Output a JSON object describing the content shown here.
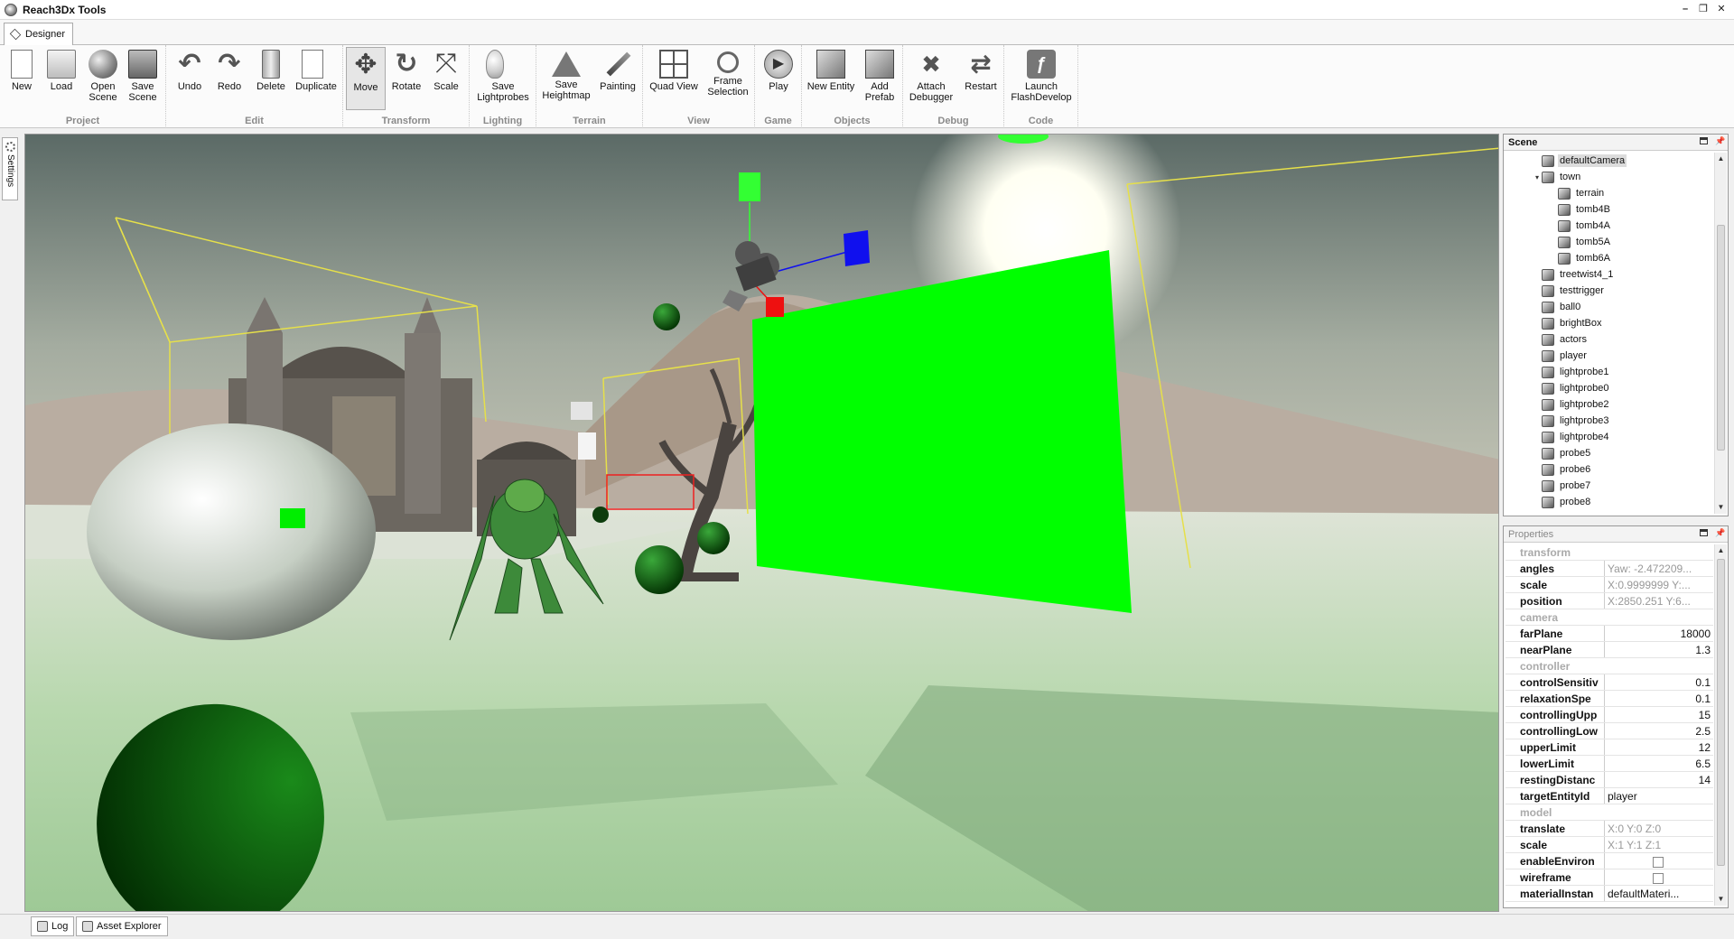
{
  "window": {
    "title": "Reach3Dx Tools",
    "minimize": "–",
    "restore": "❐",
    "close": "✕"
  },
  "tabs": {
    "designer": "Designer"
  },
  "ribbon": {
    "project": {
      "label": "Project",
      "new": "New",
      "load": "Load",
      "open_scene": "Open\nScene",
      "save_scene": "Save\nScene"
    },
    "edit": {
      "label": "Edit",
      "undo": "Undo",
      "redo": "Redo",
      "delete": "Delete",
      "duplicate": "Duplicate"
    },
    "transform": {
      "label": "Transform",
      "move": "Move",
      "rotate": "Rotate",
      "scale": "Scale"
    },
    "lighting": {
      "label": "Lighting",
      "save_lightprobes": "Save\nLightprobes"
    },
    "terrain": {
      "label": "Terrain",
      "save_heightmap": "Save\nHeightmap",
      "painting": "Painting"
    },
    "view": {
      "label": "View",
      "quad_view": "Quad View",
      "frame_selection": "Frame\nSelection"
    },
    "game": {
      "label": "Game",
      "play": "Play"
    },
    "objects": {
      "label": "Objects",
      "new_entity": "New Entity",
      "add_prefab": "Add\nPrefab"
    },
    "debug": {
      "label": "Debug",
      "attach_debugger": "Attach\nDebugger",
      "restart": "Restart"
    },
    "code": {
      "label": "Code",
      "launch_flashdevelop": "Launch\nFlashDevelop"
    }
  },
  "left": {
    "settings": "Settings"
  },
  "scene": {
    "title": "Scene",
    "items": [
      {
        "label": "defaultCamera",
        "depth": 1,
        "selected": true
      },
      {
        "label": "town",
        "depth": 1,
        "expanded": true
      },
      {
        "label": "terrain",
        "depth": 2
      },
      {
        "label": "tomb4B",
        "depth": 2
      },
      {
        "label": "tomb4A",
        "depth": 2
      },
      {
        "label": "tomb5A",
        "depth": 2
      },
      {
        "label": "tomb6A",
        "depth": 2
      },
      {
        "label": "treetwist4_1",
        "depth": 1
      },
      {
        "label": "testtrigger",
        "depth": 1
      },
      {
        "label": "ball0",
        "depth": 1
      },
      {
        "label": "brightBox",
        "depth": 1
      },
      {
        "label": "actors",
        "depth": 1
      },
      {
        "label": "player",
        "depth": 1
      },
      {
        "label": "lightprobe1",
        "depth": 1
      },
      {
        "label": "lightprobe0",
        "depth": 1
      },
      {
        "label": "lightprobe2",
        "depth": 1
      },
      {
        "label": "lightprobe3",
        "depth": 1
      },
      {
        "label": "lightprobe4",
        "depth": 1
      },
      {
        "label": "probe5",
        "depth": 1
      },
      {
        "label": "probe6",
        "depth": 1
      },
      {
        "label": "probe7",
        "depth": 1
      },
      {
        "label": "probe8",
        "depth": 1
      }
    ]
  },
  "properties": {
    "title": "Properties",
    "rows": [
      {
        "type": "cat",
        "label": "transform"
      },
      {
        "name": "angles",
        "value": "Yaw: -2.472209...",
        "style": "grey"
      },
      {
        "name": "scale",
        "value": "X:0.9999999 Y:...",
        "style": "grey"
      },
      {
        "name": "position",
        "value": "X:2850.251 Y:6...",
        "style": "grey"
      },
      {
        "type": "cat",
        "label": "camera"
      },
      {
        "name": "farPlane",
        "value": "18000",
        "style": "num"
      },
      {
        "name": "nearPlane",
        "value": "1.3",
        "style": "num"
      },
      {
        "type": "cat",
        "label": "controller"
      },
      {
        "name": "controlSensitiv",
        "value": "0.1",
        "style": "num"
      },
      {
        "name": "relaxationSpe",
        "value": "0.1",
        "style": "num"
      },
      {
        "name": "controllingUpp",
        "value": "15",
        "style": "num"
      },
      {
        "name": "controllingLow",
        "value": "2.5",
        "style": "num"
      },
      {
        "name": "upperLimit",
        "value": "12",
        "style": "num"
      },
      {
        "name": "lowerLimit",
        "value": "6.5",
        "style": "num"
      },
      {
        "name": "restingDistanc",
        "value": "14",
        "style": "num"
      },
      {
        "name": "targetEntityId",
        "value": "player",
        "style": "text"
      },
      {
        "type": "cat",
        "label": "model"
      },
      {
        "name": "translate",
        "value": "X:0 Y:0 Z:0",
        "style": "grey"
      },
      {
        "name": "scale",
        "value": "X:1 Y:1 Z:1",
        "style": "grey"
      },
      {
        "name": "enableEnviron",
        "value": "",
        "style": "check",
        "checked": false
      },
      {
        "name": "wireframe",
        "value": "",
        "style": "check",
        "checked": false
      },
      {
        "name": "materialInstan",
        "value": "defaultMateri...",
        "style": "text"
      }
    ]
  },
  "bottom": {
    "log": "Log",
    "asset_explorer": "Asset Explorer"
  },
  "colors": {
    "gizmo_green": "#33ff33",
    "gizmo_blue": "#1010ee",
    "gizmo_red": "#ee1010",
    "bounds_yellow": "#e6e04a"
  }
}
